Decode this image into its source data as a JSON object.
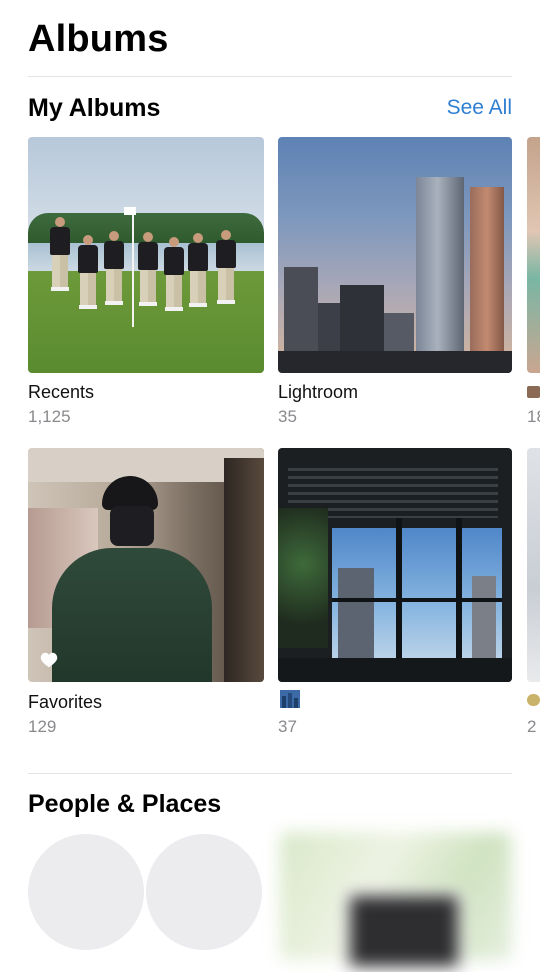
{
  "page": {
    "title": "Albums"
  },
  "my_albums": {
    "section_title": "My Albums",
    "see_all_label": "See All",
    "albums": [
      {
        "name": "Recents",
        "count": "1,125"
      },
      {
        "name": "Lightroom",
        "count": "35"
      },
      {
        "name": "",
        "count": "18"
      },
      {
        "name": "Favorites",
        "count": "129"
      },
      {
        "name": "",
        "count": "37"
      },
      {
        "name": "",
        "count": "2"
      }
    ]
  },
  "people_places": {
    "section_title": "People & Places"
  },
  "colors": {
    "accent": "#2f7fd1",
    "secondary_text": "#8a8a8e",
    "divider": "#e3e3e7"
  },
  "icons": {
    "favorite_overlay": "heart-icon",
    "album_glyph": "cityscape-icon"
  }
}
